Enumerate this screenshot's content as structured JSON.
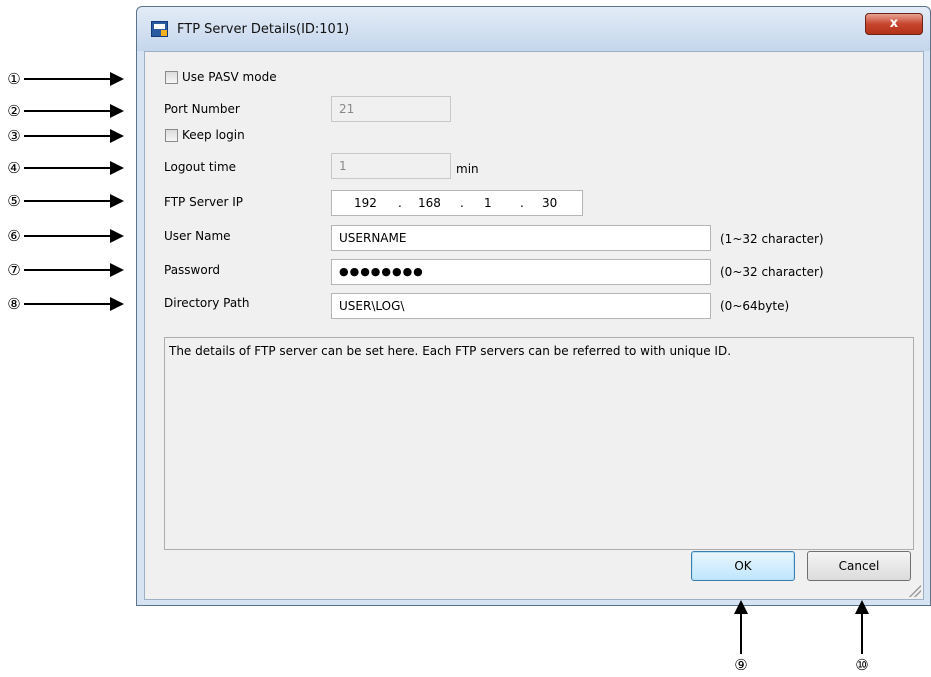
{
  "window": {
    "title": "FTP Server Details(ID:101)",
    "close_label": "x"
  },
  "form": {
    "pasv": {
      "label": "Use PASV mode",
      "checked": false
    },
    "port": {
      "label": "Port Number",
      "value": "21"
    },
    "keep_login": {
      "label": "Keep login",
      "checked": false
    },
    "logout": {
      "label": "Logout time",
      "value": "1",
      "unit": "min"
    },
    "ip": {
      "label": "FTP Server IP",
      "octets": [
        "192",
        "168",
        "1",
        "30"
      ],
      "separator": "."
    },
    "user": {
      "label": "User Name",
      "value": "USERNAME",
      "hint": "(1~32 character)"
    },
    "password": {
      "label": "Password",
      "value": "●●●●●●●●",
      "hint": "(0~32 character)"
    },
    "directory": {
      "label": "Directory Path",
      "value": "USER\\LOG\\",
      "hint": "(0~64byte)"
    }
  },
  "info_text": "The details of FTP server can be set here. Each FTP servers can be referred to with unique ID.",
  "buttons": {
    "ok": "OK",
    "cancel": "Cancel"
  },
  "markers": [
    "①",
    "②",
    "③",
    "④",
    "⑤",
    "⑥",
    "⑦",
    "⑧",
    "⑨",
    "⑩"
  ]
}
